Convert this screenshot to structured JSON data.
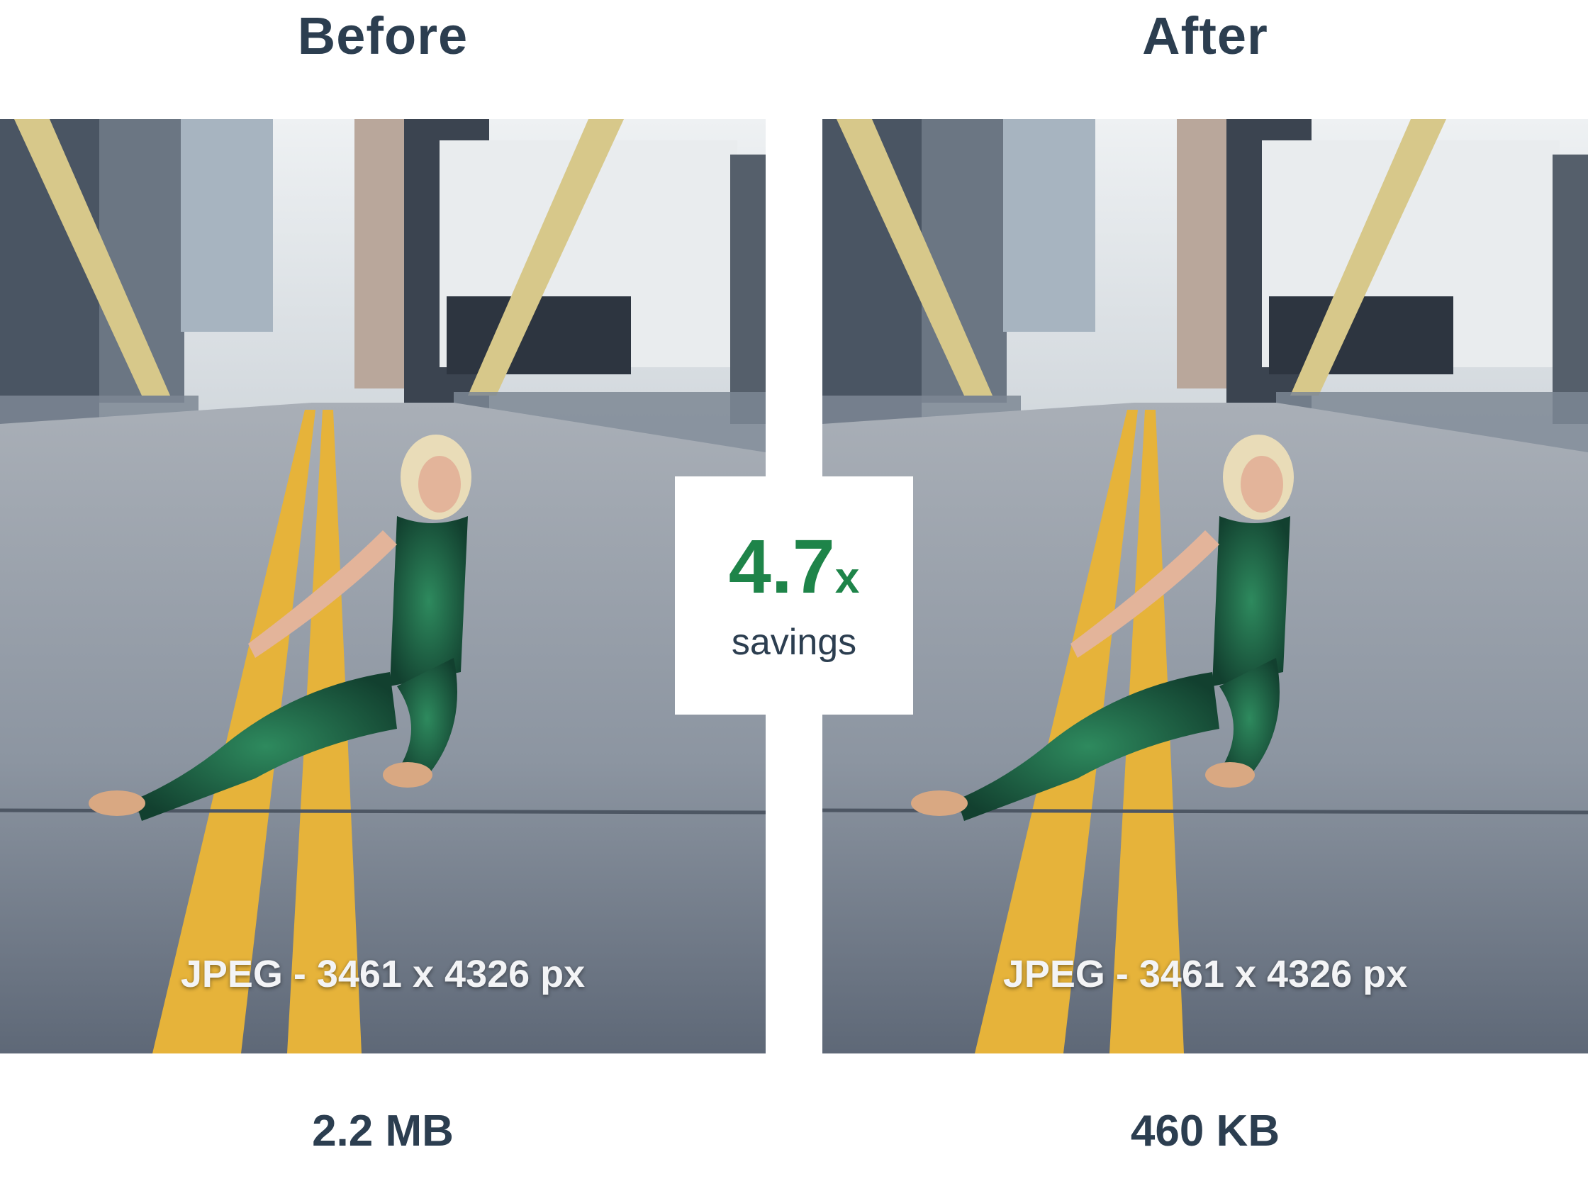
{
  "comparison": {
    "before": {
      "heading": "Before",
      "format_label": "JPEG - 3461 x 4326 px",
      "size": "2.2 MB"
    },
    "after": {
      "heading": "After",
      "format_label": "JPEG - 3461 x 4326 px",
      "size": "460 KB"
    }
  },
  "savings": {
    "value": "4.7",
    "unit": "x",
    "label": "savings"
  },
  "colors": {
    "heading_text": "#2c3e50",
    "savings_accent": "#1e8449",
    "road": "#7c8795",
    "lane_marking": "#e6b33a"
  }
}
